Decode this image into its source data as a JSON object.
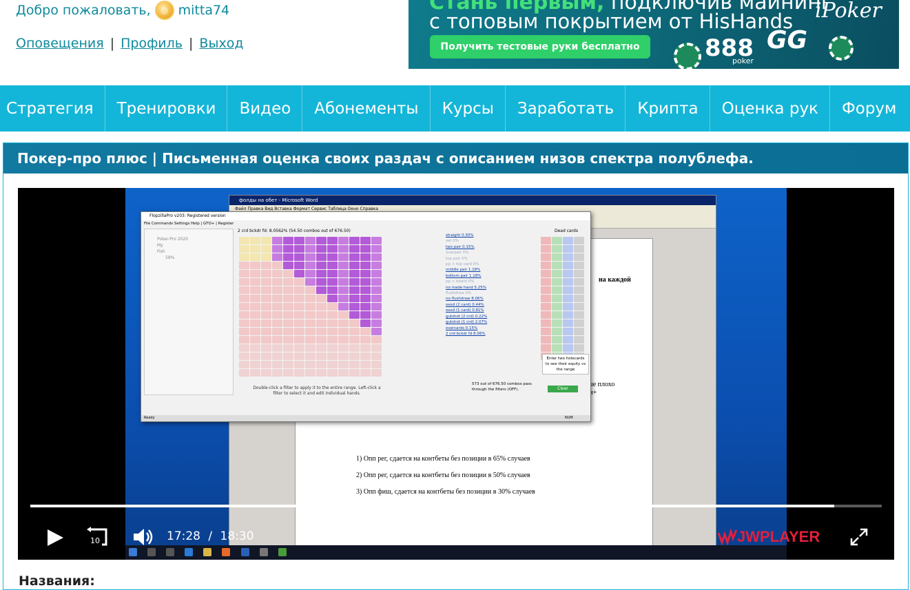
{
  "header": {
    "welcome_text": "Добро пожаловать,",
    "username": "mitta74",
    "links": [
      "Оповещения",
      "Профиль",
      "Выход"
    ],
    "separator": "|"
  },
  "banner": {
    "line1_highlight": "Стань первым,",
    "line1_rest": " подключив майнинг",
    "line2": "с топовым покрытием от HisHands",
    "button": "Получить тестовые руки бесплатно",
    "logo_888": "888",
    "logo_888_sub": "poker",
    "logo_gg": "GG",
    "logo_ipoker": "iPoker"
  },
  "nav": {
    "items": [
      "Стратегия",
      "Тренировки",
      "Видео",
      "Абонементы",
      "Курсы",
      "Заработать",
      "Крипта",
      "Оценка рук",
      "Форум"
    ]
  },
  "card": {
    "title": "Покер-про плюс | Письменная оценка своих раздач с описанием низов спектра полублефа.",
    "below_heading": "Названия:"
  },
  "video": {
    "current_time": "17:28",
    "time_separator": "/",
    "duration": "18:30",
    "progress_fraction": 0.944,
    "brand": "JWPLAYER",
    "skip_label": "10",
    "word_title": "фолды на обет - Microsoft Word",
    "word_menu": "Файл  Правка  Вид  Вставка  Формат  Сервис  Таблица  Окно  Справка",
    "word_lines": [
      "1)  Опп рег, сдается на контбеты без позиции в 65% случаев",
      "2)  Опп рег, сдается на контбеты без позиции в 50% случаев",
      "3)  Опп фиш, сдается на контбеты без позиции в 30% случаев"
    ],
    "word_side1": "на каждой",
    "word_side2": "рые плохо",
    "word_side3": "ми+",
    "flop_title": "FlopzillaPro v203: Registered version",
    "flop_menu": "File  Commands  Settings  Help  |  GTO+  |  Register",
    "flop_header": "2 crd bckdr fd: 8.0562%    (54.50 combos out of 676.50)",
    "tree_items": [
      "Poker-Pro 2020",
      "My",
      "Fish",
      "58%"
    ],
    "stats": [
      {
        "label": "straight",
        "value": "0.30%"
      },
      {
        "label": "set",
        "value": "0%"
      },
      {
        "label": "two pair",
        "value": "0.15%"
      },
      {
        "label": "overpair",
        "value": "0%"
      },
      {
        "label": "top pair",
        "value": "0%"
      },
      {
        "label": "pp < top card",
        "value": "0%"
      },
      {
        "label": "middle pair",
        "value": "1.18%"
      },
      {
        "label": "bottom pair",
        "value": "1.18%"
      },
      {
        "label": "pp > board",
        "value": "0%"
      },
      {
        "label": "no made hand",
        "value": "5.25%"
      },
      {
        "label": "flushdraw",
        "value": "0%"
      },
      {
        "label": "no flushdraw",
        "value": "8.06%"
      },
      {
        "label": "oesd (2 card)",
        "value": "0.44%"
      },
      {
        "label": "oesd (1 card)",
        "value": "0.81%"
      },
      {
        "label": "gutshot (2 crd)",
        "value": "0.22%"
      },
      {
        "label": "gutshot (1 crd)",
        "value": "2.07%"
      },
      {
        "label": "overcards",
        "value": "0.15%"
      },
      {
        "label": "2 crd bckdr fd",
        "value": "8.06%"
      }
    ],
    "dead_cards_label": "Dead cards",
    "enter_holecards": "Enter two holecards to see their equity vs the range",
    "clear_label": "Clear",
    "combos_text": "573 out of 676.50 combos pass through the filters (OFF).",
    "hint_text": "Double-click a filter to apply it to the entire range. Left-click a filter to select it and edit individual hands.",
    "status": "Ready",
    "num": "NUM"
  }
}
